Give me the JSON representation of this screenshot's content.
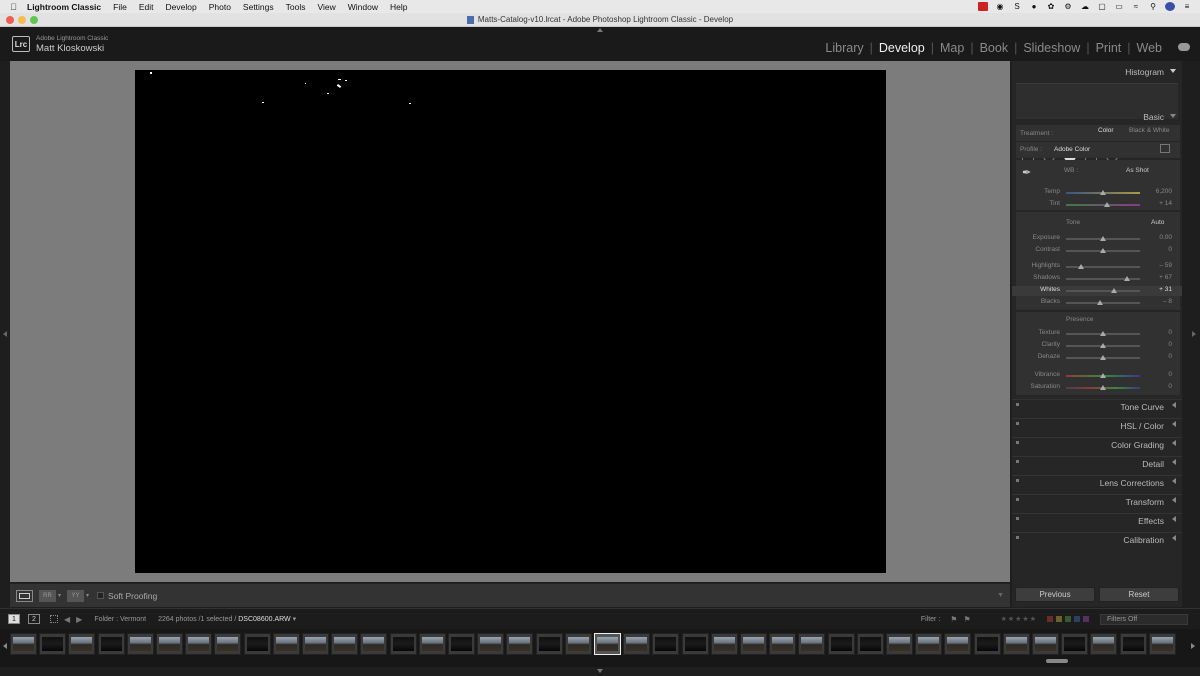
{
  "menubar": {
    "app": "Lightroom Classic",
    "items": [
      "File",
      "Edit",
      "Develop",
      "Photo",
      "Settings",
      "Tools",
      "View",
      "Window",
      "Help"
    ]
  },
  "window": {
    "title": "Matts-Catalog-v10.lrcat - Adobe Photoshop Lightroom Classic - Develop"
  },
  "identity": {
    "logo": "Lrc",
    "product": "Adobe Lightroom Classic",
    "user": "Matt Kloskowski"
  },
  "modules": [
    "Library",
    "Develop",
    "Map",
    "Book",
    "Slideshow",
    "Print",
    "Web"
  ],
  "active_module": "Develop",
  "toolbar": {
    "soft_proofing": "Soft Proofing"
  },
  "panels": {
    "histogram": "Histogram",
    "basic": "Basic",
    "treatment_label": "Treatment :",
    "treatment_color": "Color",
    "treatment_bw": "Black & White",
    "profile_label": "Profile :",
    "profile_value": "Adobe Color",
    "wb_label": "WB :",
    "wb_value": "As Shot",
    "tone_label": "Tone",
    "auto_label": "Auto",
    "presence_label": "Presence",
    "sliders": [
      {
        "name": "Temp",
        "value": "6,200",
        "pos": 0.5
      },
      {
        "name": "Tint",
        "value": "+ 14",
        "pos": 0.55
      },
      {
        "name": "Exposure",
        "value": "0.00",
        "pos": 0.5
      },
      {
        "name": "Contrast",
        "value": "0",
        "pos": 0.5
      },
      {
        "name": "Highlights",
        "value": "– 59",
        "pos": 0.2
      },
      {
        "name": "Shadows",
        "value": "+ 67",
        "pos": 0.83
      },
      {
        "name": "Whites",
        "value": "+ 31",
        "pos": 0.65
      },
      {
        "name": "Blacks",
        "value": "– 8",
        "pos": 0.46
      },
      {
        "name": "Texture",
        "value": "0",
        "pos": 0.5
      },
      {
        "name": "Clarity",
        "value": "0",
        "pos": 0.5
      },
      {
        "name": "Dehaze",
        "value": "0",
        "pos": 0.5
      },
      {
        "name": "Vibrance",
        "value": "0",
        "pos": 0.5
      },
      {
        "name": "Saturation",
        "value": "0",
        "pos": 0.5
      }
    ],
    "collapsed": [
      "Tone Curve",
      "HSL / Color",
      "Color Grading",
      "Detail",
      "Lens Corrections",
      "Transform",
      "Effects",
      "Calibration"
    ],
    "previous": "Previous",
    "reset": "Reset"
  },
  "filmstrip_bar": {
    "page1": "1",
    "page2": "2",
    "source": "Folder : Vermont",
    "count": "2264 photos /1 selected /",
    "filename": "DSC08600.ARW",
    "filter_label": "Filter :",
    "filters_off": "Filters Off"
  },
  "colors": {
    "active_module": "#f0f0f0",
    "inactive_module": "#8a8a8a",
    "panel_bg": "#262626",
    "canvas_bg": "#7c7c7c"
  }
}
